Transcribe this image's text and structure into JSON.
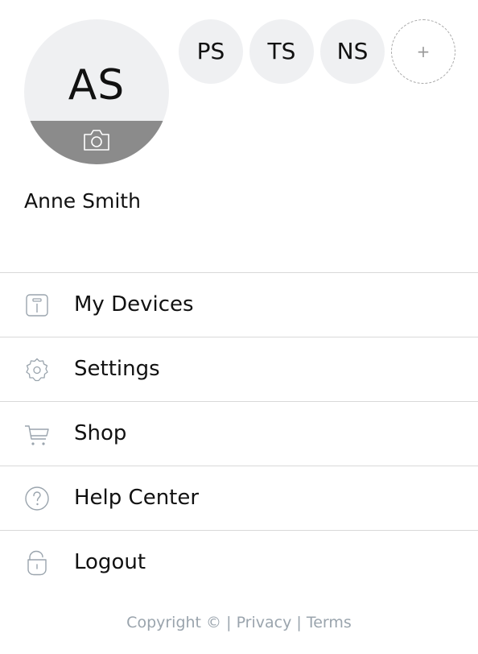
{
  "profile": {
    "initials": "AS",
    "name": "Anne Smith"
  },
  "family_members": [
    {
      "initials": "PS"
    },
    {
      "initials": "TS"
    },
    {
      "initials": "NS"
    }
  ],
  "add_member_symbol": "+",
  "menu": {
    "items": [
      {
        "label": "My Devices",
        "icon": "device-icon"
      },
      {
        "label": "Settings",
        "icon": "gear-icon"
      },
      {
        "label": "Shop",
        "icon": "cart-icon"
      },
      {
        "label": "Help Center",
        "icon": "help-icon"
      },
      {
        "label": "Logout",
        "icon": "unlock-icon"
      }
    ]
  },
  "footer": {
    "copyright": "Copyright ©",
    "separator": "|",
    "privacy": "Privacy",
    "terms": "Terms"
  },
  "colors": {
    "avatar_bg": "#eff0f2",
    "photo_band": "#8b8b8b",
    "icon_stroke": "#9aa4ad",
    "divider": "#d9d9d9",
    "footer_text": "#9aa4ad"
  }
}
